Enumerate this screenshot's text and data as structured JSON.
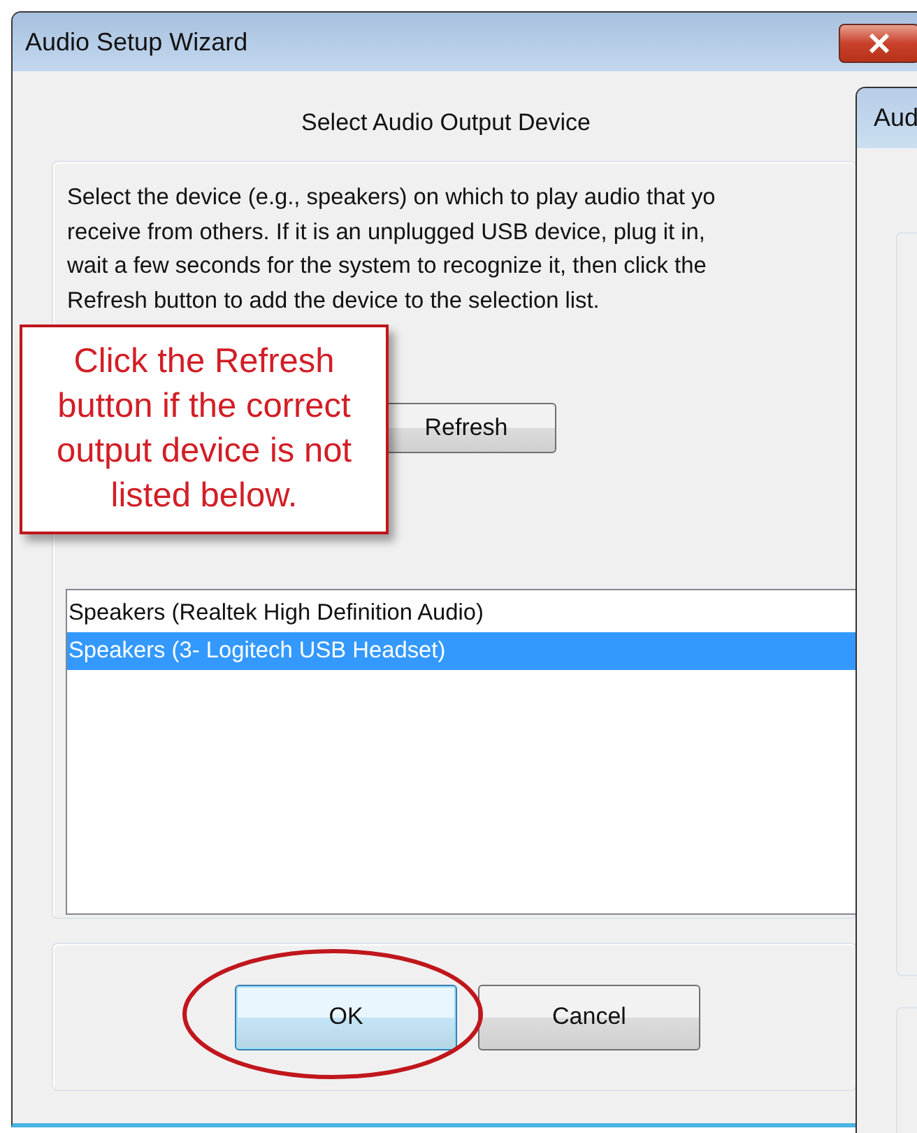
{
  "window": {
    "title": "Audio Setup Wizard"
  },
  "heading": "Select Audio Output Device",
  "description": "Select the device (e.g., speakers) on which to play audio that yo\nreceive from others. If it is an unplugged USB device, plug it in,\nwait a few seconds for the system to recognize it, then click the\nRefresh button to add the device to the selection list.",
  "refresh_button": "Refresh",
  "callout": "Click the Refresh button if the correct output device is not listed below.",
  "devices": [
    {
      "name": "Speakers (Realtek High Definition Audio)",
      "selected": false
    },
    {
      "name": "Speakers (3- Logitech USB Headset)",
      "selected": true
    }
  ],
  "buttons": [
    {
      "label": "OK",
      "kind": "default"
    },
    {
      "label": "Cancel",
      "kind": "normal"
    }
  ],
  "background_window": {
    "title": "Aud"
  }
}
